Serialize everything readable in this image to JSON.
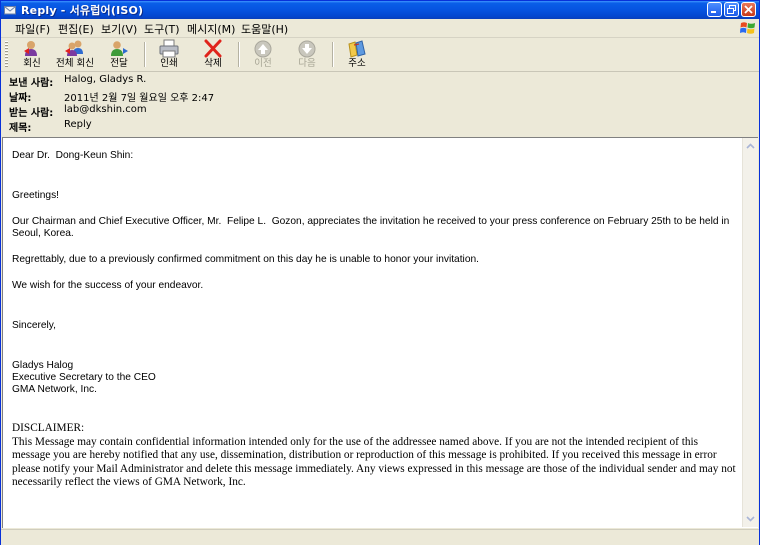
{
  "window": {
    "title": "Reply  - 서유럽어(ISO)"
  },
  "menu": [
    "파일(F)",
    "편집(E)",
    "보기(V)",
    "도구(T)",
    "메시지(M)",
    "도움말(H)"
  ],
  "toolbar": {
    "reply": "회신",
    "reply_all": "전체 회신",
    "forward": "전달",
    "print": "인쇄",
    "delete": "삭제",
    "previous": "이전",
    "next": "다음",
    "addresses": "주소"
  },
  "header": {
    "from_label": "보낸 사람:",
    "from_value": "Halog, Gladys R.",
    "date_label": "날짜:",
    "date_value": "2011년 2월 7일 월요일 오후 2:47",
    "to_label": "받는 사람:",
    "to_value": "lab@dkshin.com",
    "subject_label": "제목:",
    "subject_value": "Reply"
  },
  "body": {
    "salutation": "Dear Dr.  Dong-Keun Shin:",
    "greeting": "Greetings!",
    "p1": "Our Chairman and Chief Executive Officer, Mr.  Felipe L.  Gozon, appreciates the invitation he received to your press conference on February 25th to be held in Seoul, Korea.",
    "p2": "Regrettably, due to a previously confirmed commitment on this day he is unable to honor your invitation.",
    "p3": "We wish for the success of your endeavor.",
    "closing": "Sincerely,",
    "sig_name": "Gladys Halog",
    "sig_title": "Executive Secretary to the CEO",
    "sig_company": "GMA Network, Inc.",
    "disclaimer_title": "DISCLAIMER:",
    "disclaimer_text": "This Message may contain confidential information intended only for the use of the addressee named above. If you are not the intended recipient of this message you are hereby notified that any use, dissemination, distribution or reproduction of this message is prohibited. If you received this message in error please notify your Mail Administrator and delete this message immediately. Any views expressed in this message are those of the individual sender and may not necessarily reflect the views of GMA Network, Inc."
  },
  "colors": {
    "titlebar": "#0653e0",
    "chrome": "#ece9d8",
    "delete_x": "#e0241c"
  },
  "icons": {
    "reply": "reply-icon",
    "reply_all": "reply-all-icon",
    "forward": "forward-icon",
    "print": "printer-icon",
    "delete": "delete-x-icon",
    "previous": "arrow-up-icon",
    "next": "arrow-down-icon",
    "addresses": "address-book-icon"
  }
}
